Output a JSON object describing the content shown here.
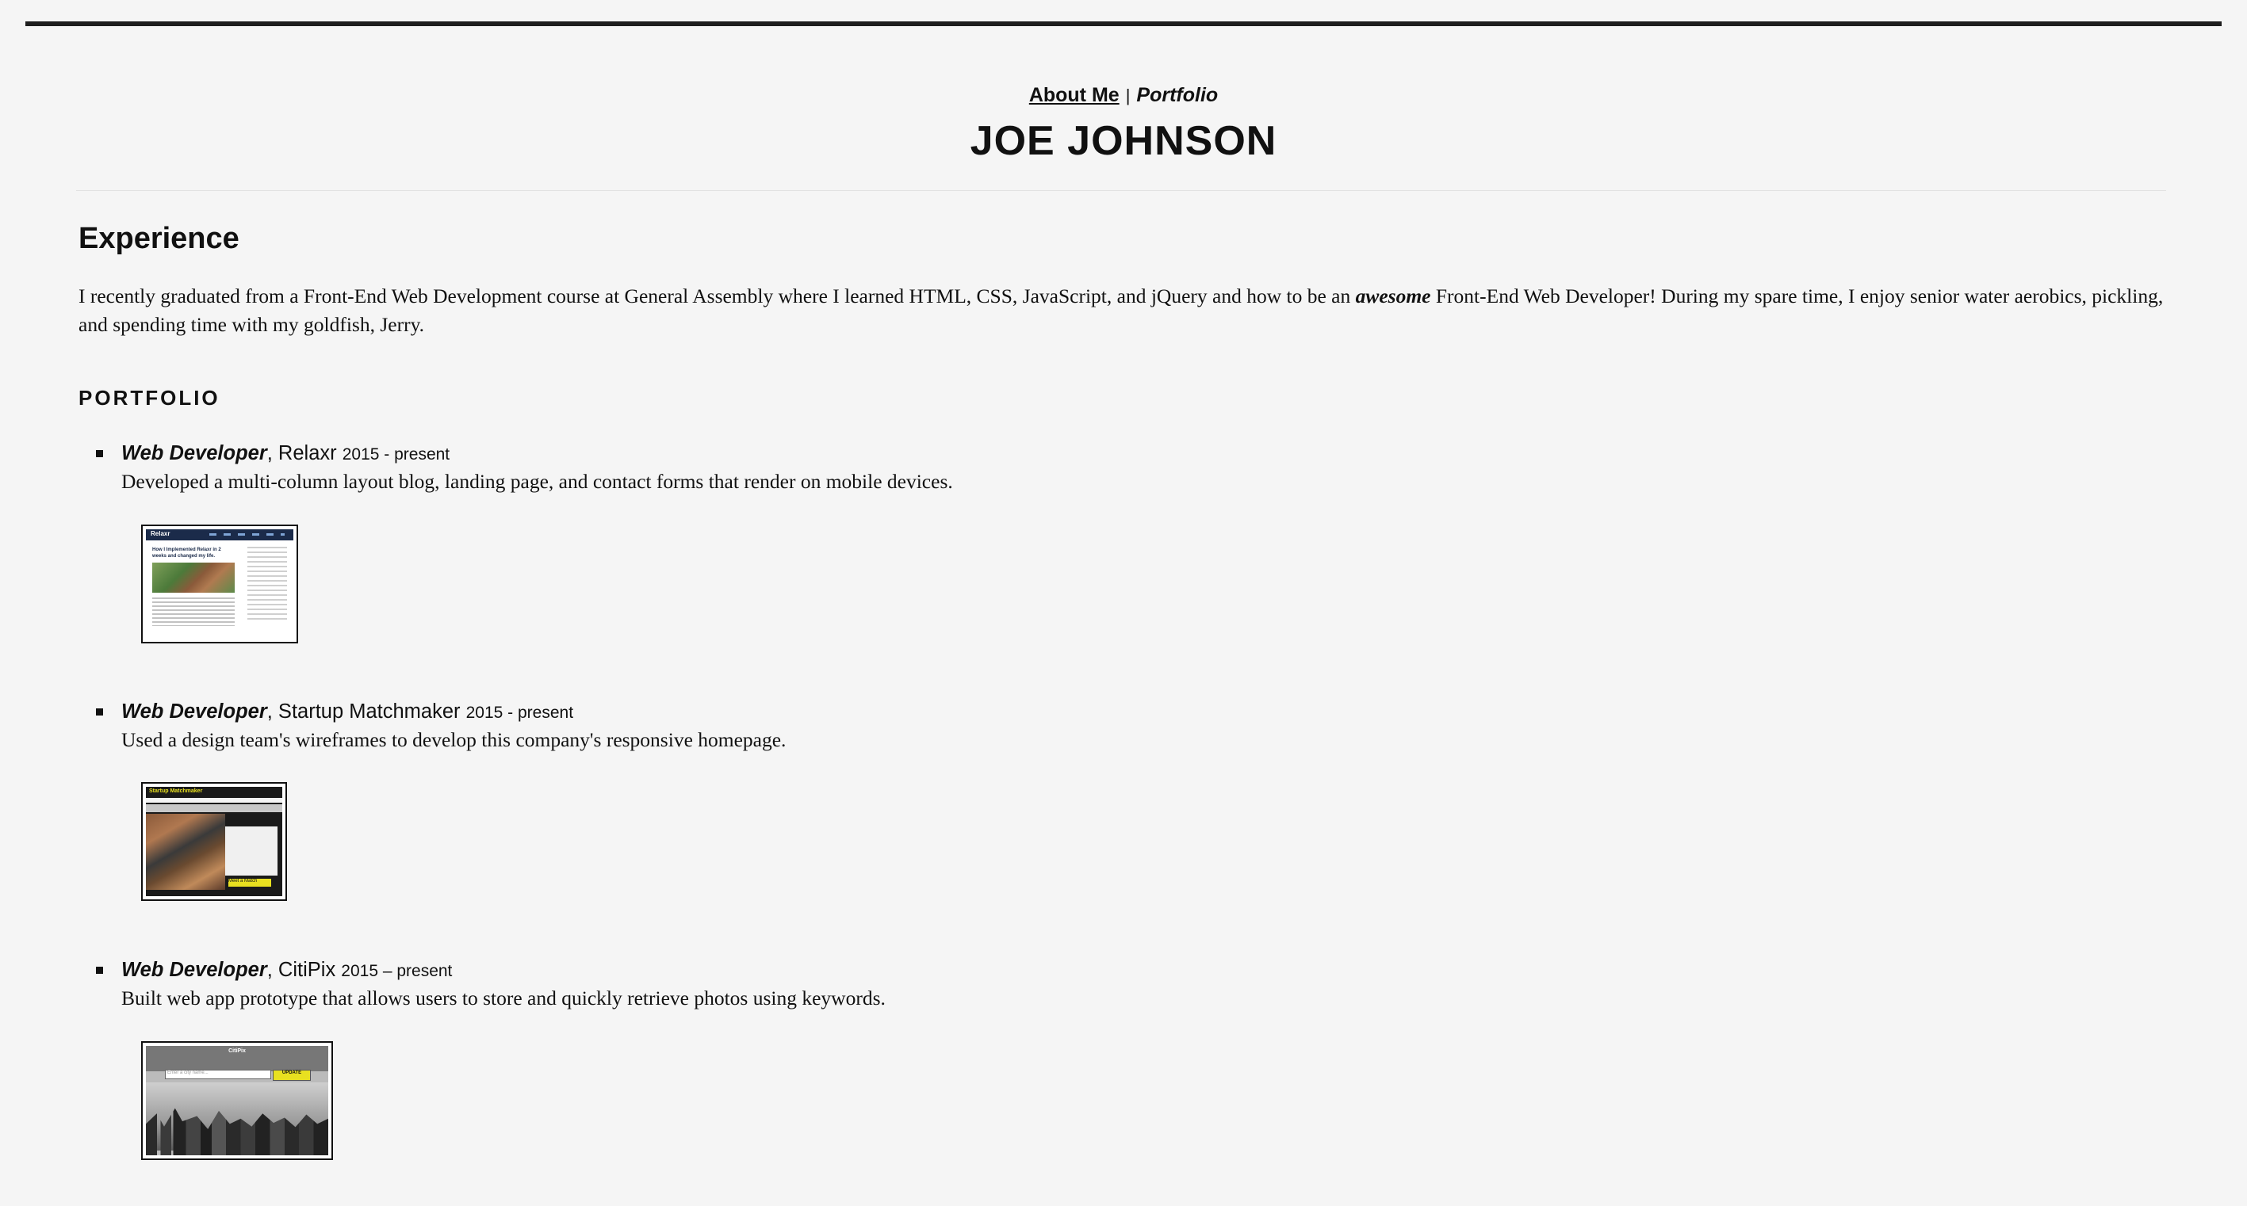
{
  "nav": {
    "about_label": "About Me",
    "separator": "|",
    "portfolio_label": "Portfolio"
  },
  "header": {
    "title": "JOE JOHNSON"
  },
  "experience": {
    "heading": "Experience",
    "bio_before": "I recently graduated from a Front-End Web Development course at General Assembly where I learned HTML, CSS, JavaScript, and jQuery and how to be an ",
    "bio_emphasis": "awesome",
    "bio_after": " Front-End Web Developer! During my spare time, I enjoy senior water aerobics, pickling, and spending time with my goldfish, Jerry."
  },
  "portfolio": {
    "heading": "PORTFOLIO",
    "jobs": [
      {
        "role": "Web Developer",
        "company": ", Relaxr ",
        "dates": "2015 - present",
        "description": "Developed a multi-column layout blog, landing page, and contact forms that render on mobile devices.",
        "thumb": {
          "logo": "Relaxr",
          "headline": "How I Implemented Relaxr in 2 weeks and changed my life."
        }
      },
      {
        "role": "Web Developer",
        "company": ", Startup Matchmaker ",
        "dates": "2015 - present",
        "description": "Used a design team's wireframes to develop this company's responsive homepage.",
        "thumb": {
          "title": "Startup Matchmaker",
          "button": "Meet a Match"
        }
      },
      {
        "role": "Web Developer",
        "company": ", CitiPix ",
        "dates": "2015 – present",
        "description": "Built web app prototype that allows users to store and quickly retrieve photos using keywords.",
        "thumb": {
          "title": "CitiPix",
          "input_placeholder": "Enter a city name...",
          "button": "UPDATE"
        }
      }
    ]
  }
}
